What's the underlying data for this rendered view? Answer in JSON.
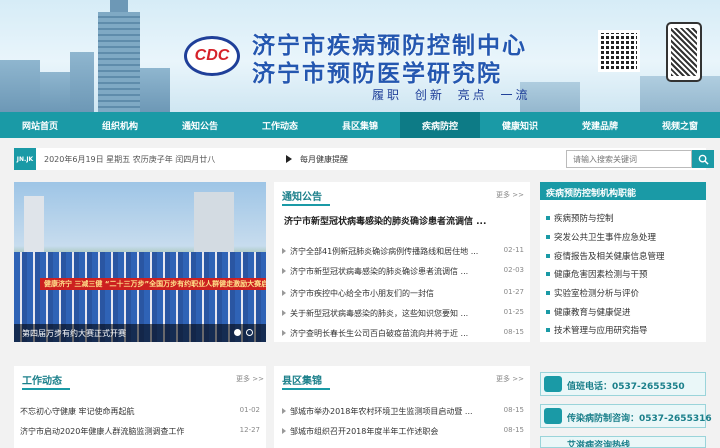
{
  "header": {
    "logo_text": "CDC",
    "title_1": "济宁市疾病预防控制中心",
    "title_2": "济宁市预防医学研究院",
    "slogan": "履职 创新 亮点 一流"
  },
  "nav": {
    "items": [
      "网站首页",
      "组织机构",
      "通知公告",
      "工作动态",
      "县区集锦",
      "疾病防控",
      "健康知识",
      "党建品牌",
      "视频之窗"
    ],
    "active_index": 5
  },
  "infobar": {
    "tag": "JN.JK",
    "date": "2020年6月19日 星期五 农历庚子年 闰四月廿八",
    "tip": "每月健康提醒",
    "search_placeholder": "请输入搜索关键词"
  },
  "slider": {
    "banner_text": "健康济宁  三减三健  “二十三万步”全国万步有约职业人群健走激励大赛启动仪式",
    "caption": "第四届万步有约大赛正式开赛"
  },
  "notice": {
    "title": "通知公告",
    "more": "更多 >>",
    "headline": "济宁市新型冠状病毒感染的肺炎确诊患者流调信 ...",
    "items": [
      {
        "text": "济宁全部41例新冠肺炎确诊病例传播路线和居住地 ...",
        "date": "02-11"
      },
      {
        "text": "济宁市新型冠状病毒感染的肺炎确诊患者流调信 ...",
        "date": "02-03"
      },
      {
        "text": "济宁市疾控中心给全市小朋友们的一封信",
        "date": "01-27"
      },
      {
        "text": "关于新型冠状病毒感染的肺炎，这些知识您要知 ...",
        "date": "01-25"
      },
      {
        "text": "济宁查明长春长生公司百白破疫苗流向并将于近 ...",
        "date": "08-15"
      }
    ]
  },
  "functions": {
    "title": "疾病预防控制机构职能",
    "items": [
      "疾病预防与控制",
      "突发公共卫生事件应急处理",
      "疫情报告及相关健康信息管理",
      "健康危害因素检测与干预",
      "实验室检测分析与评价",
      "健康教育与健康促进",
      "技术管理与应用研究指导"
    ]
  },
  "work": {
    "title": "工作动态",
    "more": "更多 >>",
    "items": [
      {
        "text": "不忘初心守健康 牢记使命再起航",
        "date": "01-02"
      },
      {
        "text": "济宁市启动2020年健康人群流脑监测调查工作",
        "date": "12-27"
      }
    ]
  },
  "region": {
    "title": "县区集锦",
    "more": "更多 >>",
    "items": [
      {
        "text": "邹城市举办2018年农村环境卫生监测项目启动暨 ...",
        "date": "08-15"
      },
      {
        "text": "邹城市组织召开2018年度半年工作述职会",
        "date": "08-15"
      }
    ]
  },
  "hotlines": {
    "duty": "值班电话：0537-2655350",
    "infectious": "传染病防制咨询：0537-2655316",
    "third": "艾滋病咨询热线"
  },
  "colors": {
    "accent": "#1a9aa6",
    "title_blue": "#2457b0"
  }
}
